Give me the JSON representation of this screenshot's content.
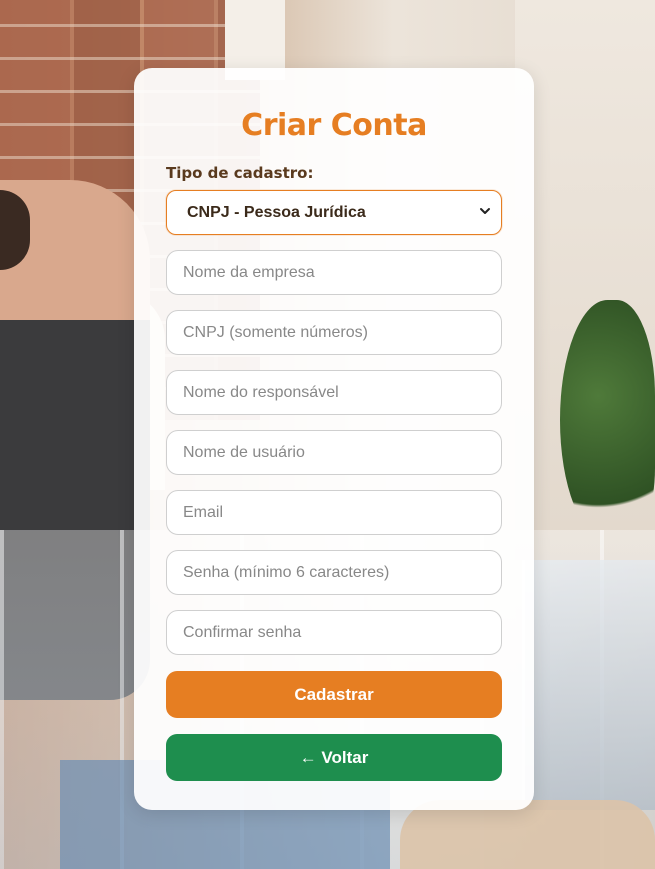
{
  "form": {
    "title": "Criar Conta",
    "type_label": "Tipo de cadastro:",
    "type_select": {
      "selected": "CNPJ - Pessoa Jurídica",
      "icon": "chevron-down-icon"
    },
    "fields": [
      {
        "placeholder": "Nome da empresa",
        "value": ""
      },
      {
        "placeholder": "CNPJ (somente números)",
        "value": ""
      },
      {
        "placeholder": "Nome do responsável",
        "value": ""
      },
      {
        "placeholder": "Nome de usuário",
        "value": ""
      },
      {
        "placeholder": "Email",
        "value": ""
      },
      {
        "placeholder": "Senha (mínimo 6 caracteres)",
        "value": ""
      },
      {
        "placeholder": "Confirmar senha",
        "value": ""
      }
    ],
    "submit_label": "Cadastrar",
    "back_label": "← Voltar"
  },
  "colors": {
    "accent": "#e67e22",
    "back_button": "#1e8e4e",
    "label": "#5a3a1e"
  }
}
